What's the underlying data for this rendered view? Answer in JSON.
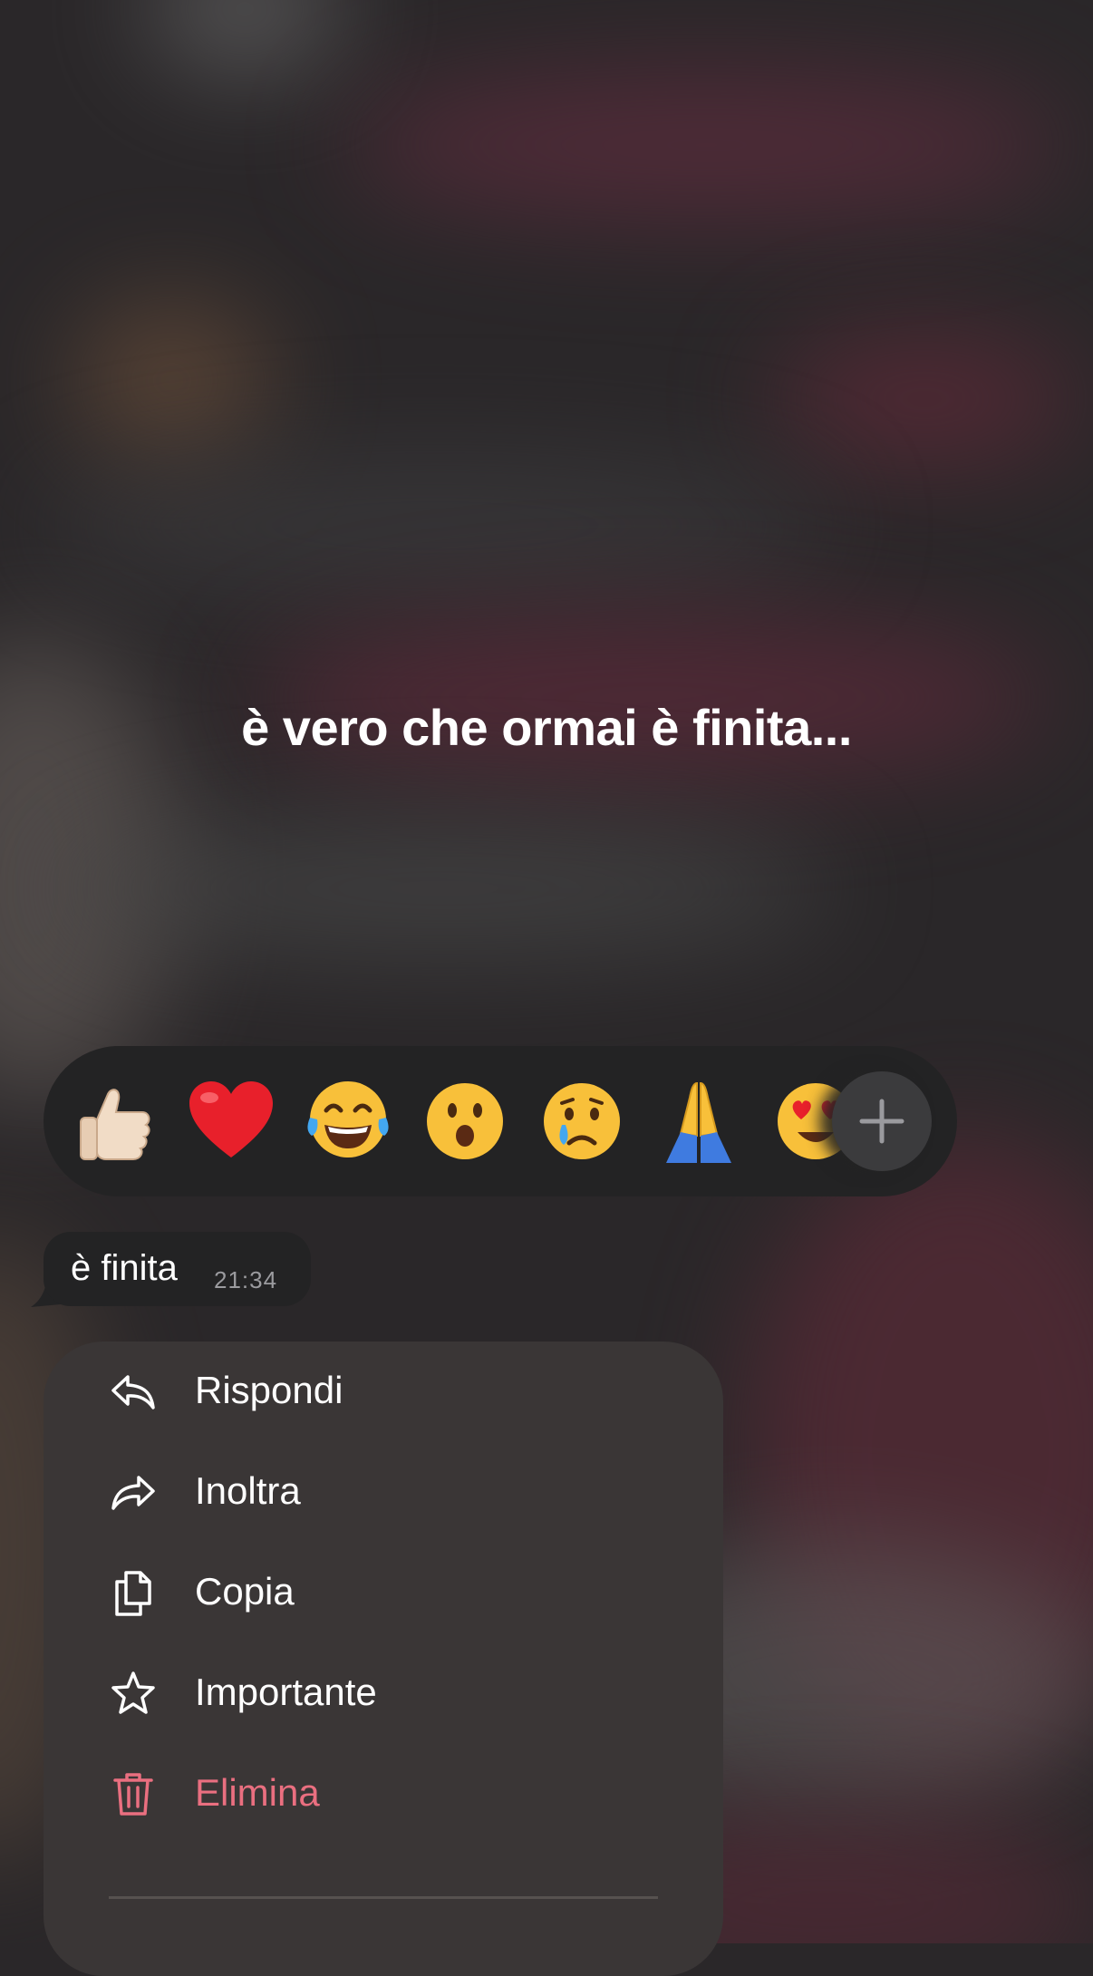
{
  "message_preview": {
    "text": "è vero che ormai è finita..."
  },
  "reactions": {
    "items": [
      {
        "name": "thumbs-up",
        "glyph": "👍🏻"
      },
      {
        "name": "red-heart",
        "glyph": "❤️"
      },
      {
        "name": "tears-of-joy",
        "glyph": "😂"
      },
      {
        "name": "surprised",
        "glyph": "😮"
      },
      {
        "name": "crying",
        "glyph": "😢"
      },
      {
        "name": "folded-hands",
        "glyph": "🙏"
      },
      {
        "name": "heart-eyes",
        "glyph": "😍"
      }
    ],
    "more_icon": "plus-icon"
  },
  "bubble": {
    "text": "è finita",
    "time": "21:34"
  },
  "menu": {
    "items": [
      {
        "label": "Rispondi",
        "icon": "reply-icon"
      },
      {
        "label": "Inoltra",
        "icon": "forward-icon"
      },
      {
        "label": "Copia",
        "icon": "copy-icon"
      },
      {
        "label": "Importante",
        "icon": "star-icon"
      },
      {
        "label": "Elimina",
        "icon": "trash-icon"
      }
    ]
  },
  "colors": {
    "danger": "#ea6f80",
    "menu_bg": "#3a3636",
    "bubble_bg": "#232324",
    "reaction_bar_bg": "#232324"
  }
}
